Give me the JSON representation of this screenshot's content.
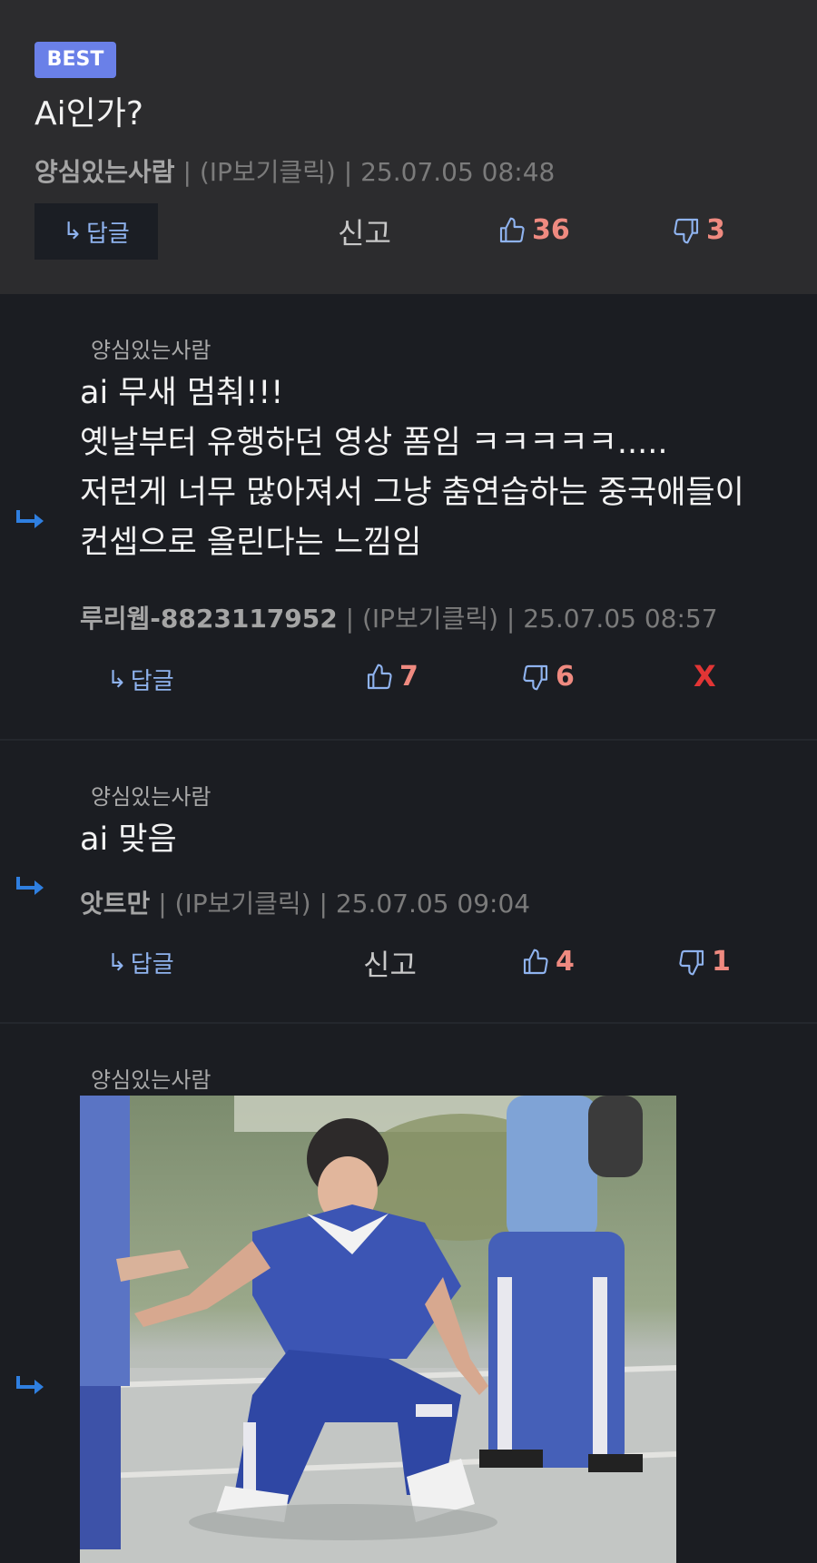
{
  "best": {
    "badge": "BEST",
    "title": "Ai인가?",
    "author": "양심있는사람",
    "ip_label": "(IP보기클릭)",
    "timestamp": "25.07.05 08:48",
    "reply_label": "답글",
    "report_label": "신고",
    "likes": "36",
    "dislikes": "3"
  },
  "comments": [
    {
      "reply_to": "양심있는사람",
      "lines": [
        "ai 무새 멈춰!!!",
        "옛날부터 유행하던 영상 폼임 ㅋㅋㅋㅋㅋ.....",
        "저런게 너무 많아져서 그냥 춤연습하는 중국애들이",
        "컨셉으로 올린다는 느낌임"
      ],
      "author": "루리웹-8823117952",
      "ip_label": "(IP보기클릭)",
      "timestamp": "25.07.05 08:57",
      "reply_label": "답글",
      "likes": "7",
      "dislikes": "6",
      "delete_label": "X"
    },
    {
      "reply_to": "양심있는사람",
      "lines": [
        "ai 맞음"
      ],
      "author": "앗트만",
      "ip_label": "(IP보기클릭)",
      "timestamp": "25.07.05 09:04",
      "reply_label": "답글",
      "report_label": "신고",
      "likes": "4",
      "dislikes": "1"
    },
    {
      "reply_to": "양심있는사람"
    }
  ],
  "colors": {
    "accent_blue": "#8fb3ef",
    "vote_count": "#ef8a80",
    "delete_red": "#e23535",
    "badge": "#6a80e8"
  }
}
